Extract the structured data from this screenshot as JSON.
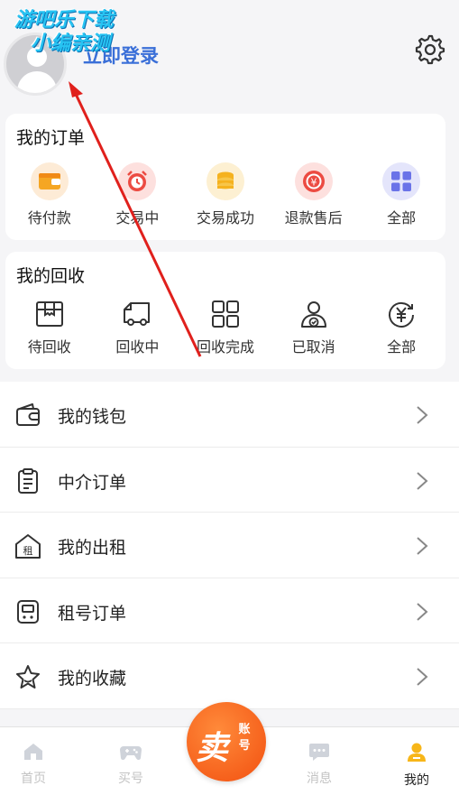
{
  "header": {
    "login_label": "立即登录",
    "watermark_line1": "游吧乐下载",
    "watermark_line2": "小编亲测"
  },
  "orders": {
    "title": "我的订单",
    "items": [
      {
        "label": "待付款",
        "icon": "wallet-icon"
      },
      {
        "label": "交易中",
        "icon": "alarm-clock-icon"
      },
      {
        "label": "交易成功",
        "icon": "coins-icon"
      },
      {
        "label": "退款售后",
        "icon": "refund-icon"
      },
      {
        "label": "全部",
        "icon": "grid-icon"
      }
    ]
  },
  "recycle": {
    "title": "我的回收",
    "items": [
      {
        "label": "待回收",
        "icon": "box-icon"
      },
      {
        "label": "回收中",
        "icon": "truck-icon"
      },
      {
        "label": "回收完成",
        "icon": "grid-outline-icon"
      },
      {
        "label": "已取消",
        "icon": "user-check-icon"
      },
      {
        "label": "全部",
        "icon": "yuan-refresh-icon"
      }
    ]
  },
  "menu": [
    {
      "label": "我的钱包",
      "icon": "wallet-outline-icon"
    },
    {
      "label": "中介订单",
      "icon": "clipboard-icon"
    },
    {
      "label": "我的出租",
      "icon": "rent-house-icon"
    },
    {
      "label": "租号订单",
      "icon": "device-icon"
    },
    {
      "label": "我的收藏",
      "icon": "star-outline-icon"
    }
  ],
  "tabbar": {
    "items": [
      {
        "label": "首页",
        "icon": "home-icon"
      },
      {
        "label": "买号",
        "icon": "gamepad-icon"
      },
      {
        "label": "消息",
        "icon": "message-icon"
      },
      {
        "label": "我的",
        "icon": "person-icon"
      }
    ],
    "sell_big": "卖",
    "sell_small": "账号"
  },
  "colors": {
    "accent_orange": "#f25010",
    "login_blue": "#3a6fd8",
    "arrow_red": "#e0201c"
  }
}
